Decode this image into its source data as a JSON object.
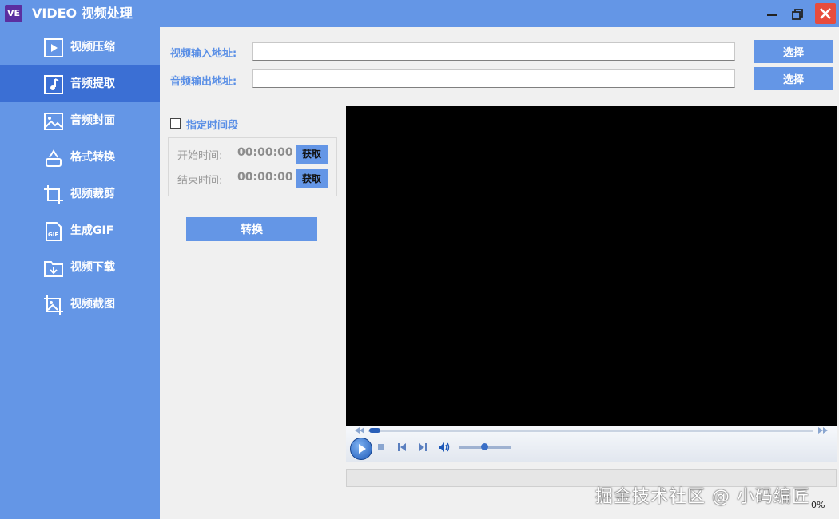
{
  "titlebar": {
    "logo": "VE",
    "title": "VIDEO 视频处理",
    "minimize_icon": "minimize-icon",
    "maximize_icon": "restore-icon",
    "close_icon": "close-icon",
    "close_color": "#e84c3d"
  },
  "sidebar": {
    "accent": "#6496e6",
    "active_color": "#3b6fd4",
    "items": [
      {
        "label": "视频压缩",
        "icon": "play-box-icon",
        "active": false
      },
      {
        "label": "音频提取",
        "icon": "music-note-icon",
        "active": true
      },
      {
        "label": "音频封面",
        "icon": "image-icon",
        "active": false
      },
      {
        "label": "格式转换",
        "icon": "convert-icon",
        "active": false
      },
      {
        "label": "视频裁剪",
        "icon": "crop-icon",
        "active": false
      },
      {
        "label": "生成GIF",
        "icon": "gif-file-icon",
        "active": false
      },
      {
        "label": "视频下载",
        "icon": "download-folder-icon",
        "active": false
      },
      {
        "label": "视频截图",
        "icon": "image-crop-icon",
        "active": false
      }
    ]
  },
  "form": {
    "video_input_label": "视频输入地址:",
    "video_input_value": "",
    "audio_output_label": "音频输出地址:",
    "audio_output_value": "",
    "select_label": "选择",
    "time_range_label": "指定时间段",
    "time_range_checked": false,
    "start_label": "开始时间:",
    "start_value": "00:00:00",
    "end_label": "结束时间:",
    "end_value": "00:00:00",
    "get_label": "获取",
    "convert_label": "转换"
  },
  "player": {
    "background": "#000000",
    "progress_text": "0%"
  },
  "watermark": "掘金技术社区 @ 小码编匠"
}
